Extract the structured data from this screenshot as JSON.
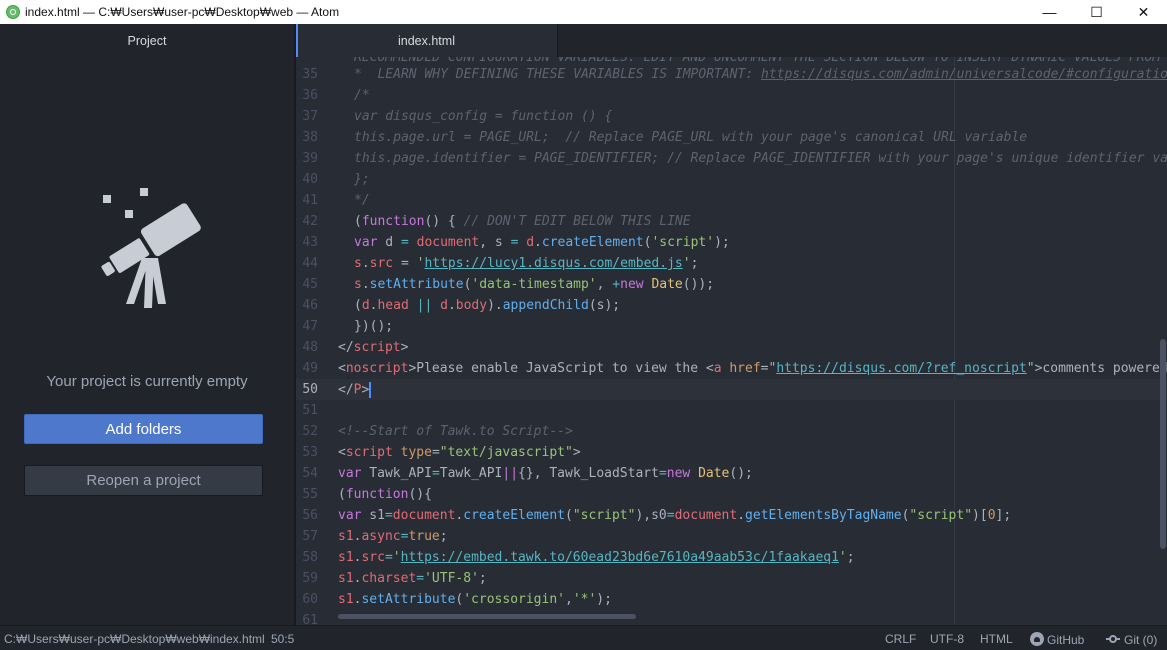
{
  "window": {
    "title": "index.html — C:₩Users₩user-pc₩Desktop₩web — Atom",
    "controls": {
      "minimize": "—",
      "maximize": "☐",
      "close": "✕"
    }
  },
  "sidebar": {
    "tab_label": "Project",
    "illustration_icon": "telescope-icon",
    "empty_message": "Your project is currently empty",
    "add_folders_label": "Add folders",
    "reopen_label": "Reopen a project"
  },
  "tabs": [
    {
      "label": "index.html",
      "active": true
    }
  ],
  "editor": {
    "first_partial_line": "RECOMMENDED CONFIGURATION VARIABLES: EDIT AND UNCOMMENT THE SECTION BELOW TO INSERT DYNAMIC VALUES FROM",
    "line_numbers": [
      "35",
      "36",
      "37",
      "38",
      "39",
      "40",
      "41",
      "42",
      "43",
      "44",
      "45",
      "46",
      "47",
      "48",
      "49",
      "50",
      "51",
      "52",
      "53",
      "54",
      "55",
      "56",
      "57",
      "58",
      "59",
      "60",
      "61"
    ],
    "cursor_line": "50",
    "lines": {
      "l35": {
        "c": "*  LEARN WHY DEFINING THESE VARIABLES IS IMPORTANT: ",
        "url": "https://disqus.com/admin/universalcode/#configuration"
      },
      "l36": "/*",
      "l37": "var disqus_config = function () {",
      "l38": "this.page.url = PAGE_URL;  // Replace PAGE_URL with your page's canonical URL variable",
      "l39": "this.page.identifier = PAGE_IDENTIFIER; // Replace PAGE_IDENTIFIER with your page's unique identifier variable",
      "l40": "};",
      "l41": "*/",
      "l42": {
        "a": "(",
        "kw": "function",
        "b": "() { ",
        "com": "// DON'T EDIT BELOW THIS LINE"
      },
      "l43": {
        "kw": "var",
        "d": " d ",
        "eq": "=",
        "doc": " document",
        "b": ", s ",
        "eq2": "=",
        "d2": " d",
        "dot": ".",
        "fn": "createElement",
        "p1": "(",
        "str": "'script'",
        "p2": ");"
      },
      "l44": {
        "s": "s",
        "dot": ".",
        "prop": "src",
        "eq": " = ",
        "q1": "'",
        "url": "https://lucy1.disqus.com/embed.js",
        "q2": "'",
        "end": ";"
      },
      "l45": {
        "s": "s",
        "dot": ".",
        "fn": "setAttribute",
        "p1": "(",
        "str": "'data-timestamp'",
        "b": ", ",
        "plus": "+",
        "kw": "new",
        "sp": " ",
        "cls": "Date",
        "p2": "());"
      },
      "l46": {
        "p1": "(",
        "d": "d",
        "dot": ".",
        "head": "head",
        "or": " || ",
        "d2": "d",
        "dot2": ".",
        "body": "body",
        "p2": ").",
        "fn": "appendChild",
        "p3": "(s);"
      },
      "l47": "})();",
      "l48": {
        "open": "</",
        "tag": "script",
        "close": ">"
      },
      "l49": {
        "open": "<",
        "tag": "noscript",
        "t1": ">Please enable JavaScript to view the <",
        "a": "a",
        "sp": " ",
        "attr": "href",
        "eq": "=\"",
        "url": "https://disqus.com/?ref_noscript",
        "q": "\"",
        "t2": ">comments powered by"
      },
      "l50": {
        "open": "</",
        "tag": "P",
        "close": ">"
      },
      "l51": "",
      "l52": "<!--Start of Tawk.to Script-->",
      "l53": {
        "open": "<",
        "tag": "script",
        "sp": " ",
        "attr": "type",
        "eq": "=",
        "str": "\"text/javascript\"",
        "close": ">"
      },
      "l54": {
        "kw": "var",
        "a": " Tawk_API",
        "eq": "=",
        "b": "Tawk_API",
        "or": "||",
        "c": "{}, Tawk_LoadStart",
        "eq2": "=",
        "kw2": "new",
        "sp": " ",
        "cls": "Date",
        "end": "();"
      },
      "l55": {
        "a": "(",
        "kw": "function",
        "b": "(){"
      },
      "l56": {
        "kw": "var",
        "v": " s1",
        "eq": "=",
        "doc": "document",
        "dot": ".",
        "fn": "createElement",
        "p1": "(",
        "str": "\"script\"",
        "c": "),s0",
        "eq2": "=",
        "doc2": "document",
        "dot2": ".",
        "fn2": "getElementsByTagName",
        "p2": "(",
        "str2": "\"script\"",
        "p3": ")[",
        "num": "0",
        "end": "];"
      },
      "l57": {
        "v": "s1",
        "dot": ".",
        "prop": "async",
        "eq": "=",
        "val": "true",
        "end": ";"
      },
      "l58": {
        "v": "s1",
        "dot": ".",
        "prop": "src",
        "eq": "=",
        "q1": "'",
        "url": "https://embed.tawk.to/60ead23bd6e7610a49aab53c/1faakaeq1",
        "q2": "'",
        "end": ";"
      },
      "l59": {
        "v": "s1",
        "dot": ".",
        "prop": "charset",
        "eq": "=",
        "str": "'UTF-8'",
        "end": ";"
      },
      "l60": {
        "v": "s1",
        "dot": ".",
        "fn": "setAttribute",
        "p1": "(",
        "str": "'crossorigin'",
        "c": ",",
        "str2": "'*'",
        "end": ");"
      }
    }
  },
  "statusbar": {
    "path": "C:₩Users₩user-pc₩Desktop₩web₩index.html",
    "cursor": "50:5",
    "line_ending": "CRLF",
    "encoding": "UTF-8",
    "grammar": "HTML",
    "github_label": "GitHub",
    "git_label": "Git (0)"
  }
}
